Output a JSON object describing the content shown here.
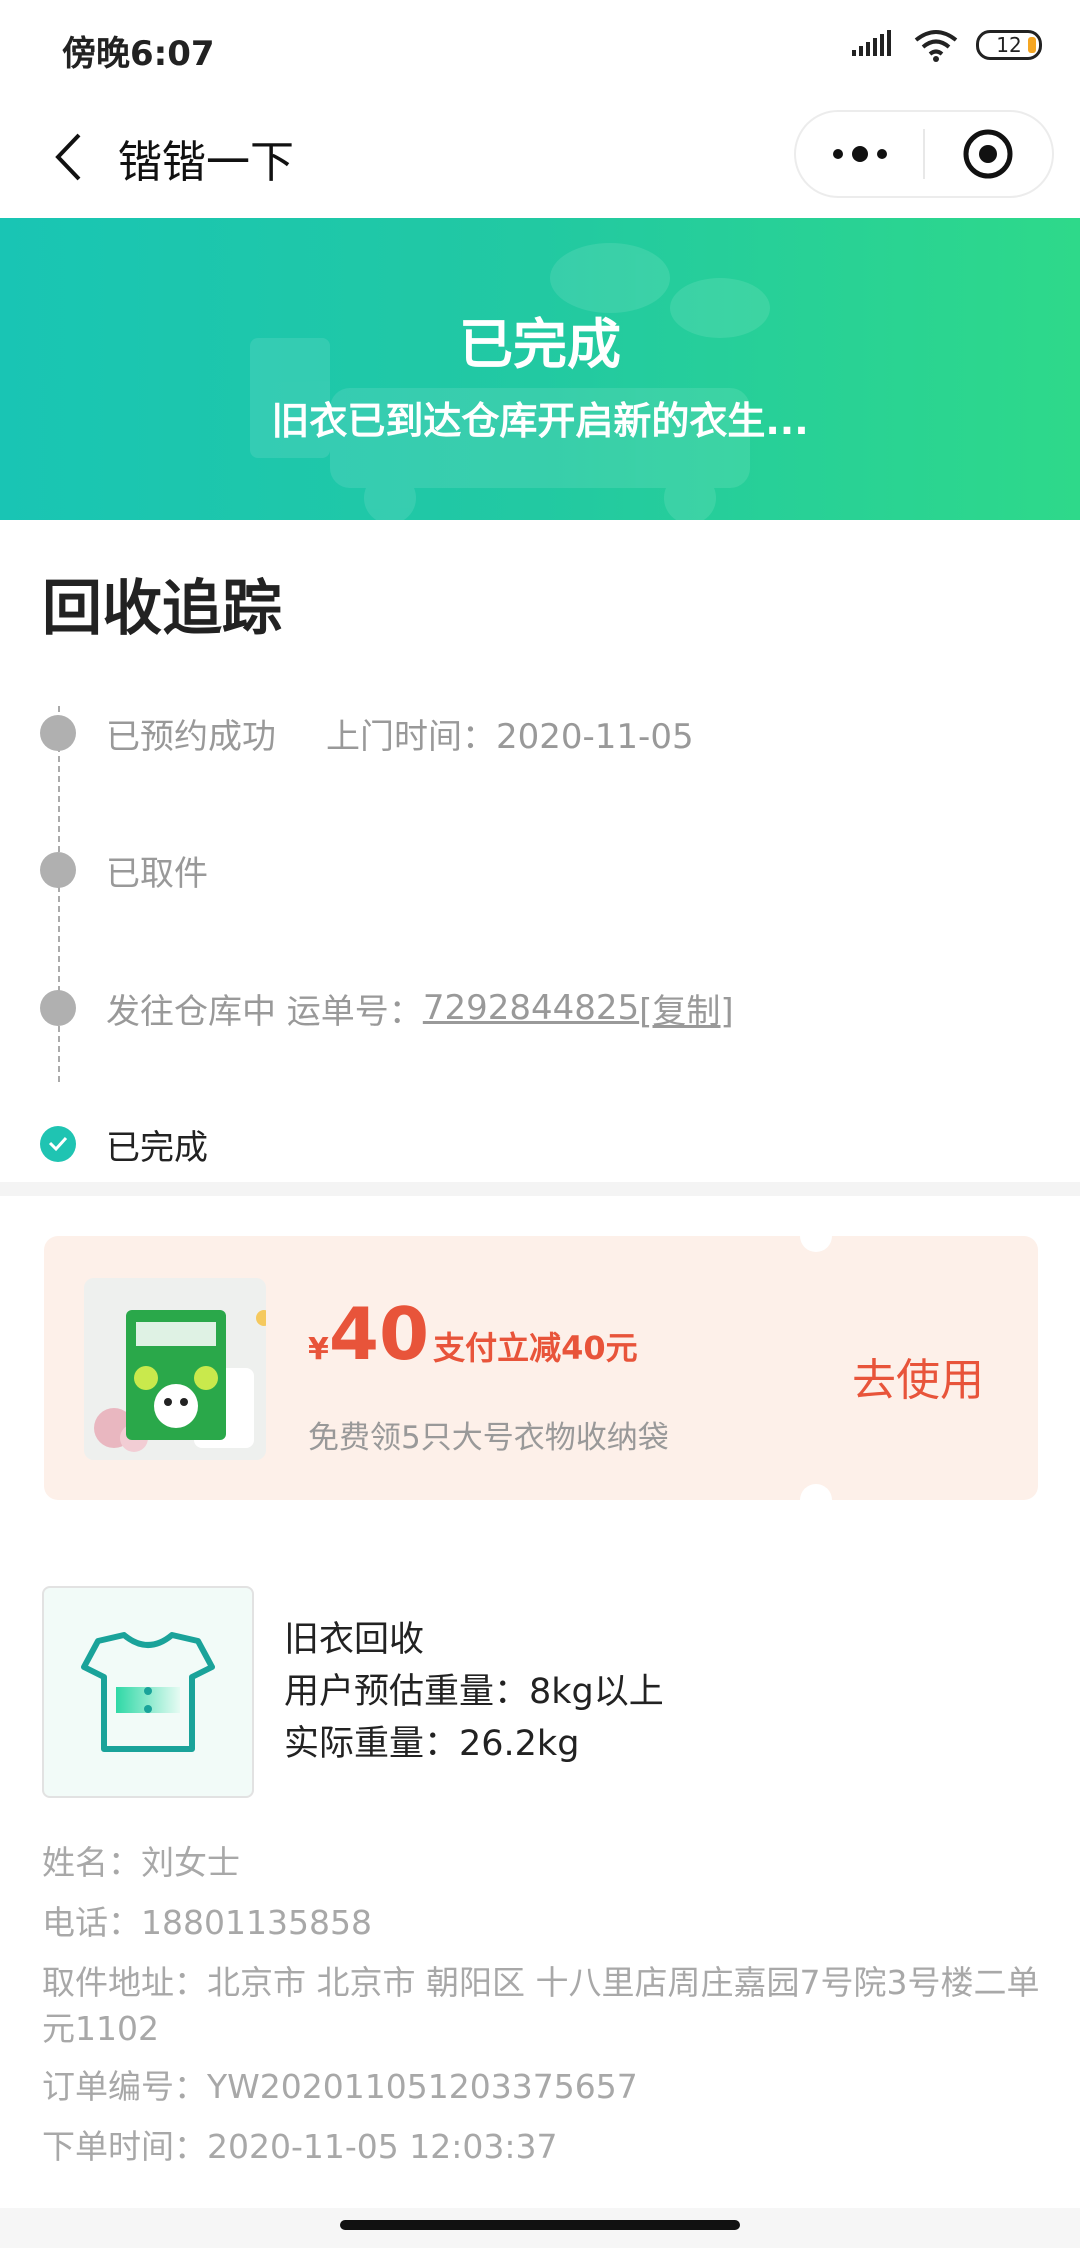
{
  "status_bar": {
    "time": "傍晚6:07",
    "battery": "12"
  },
  "nav": {
    "title": "锴锴一下"
  },
  "banner": {
    "title": "已完成",
    "subtitle": "旧衣已到达仓库开启新的衣生..."
  },
  "tracking": {
    "title": "回收追踪",
    "steps": [
      {
        "label": "已预约成功",
        "extra": "上门时间：2020-11-05"
      },
      {
        "label": "已取件"
      },
      {
        "label": "发往仓库中 运单号：",
        "tracking_no": "7292844825",
        "copy": "[复制]"
      },
      {
        "label": "已完成"
      }
    ]
  },
  "coupon": {
    "currency": "¥",
    "amount": "40",
    "amount_desc": "支付立减40元",
    "desc": "免费领5只大号衣物收纳袋",
    "action": "去使用"
  },
  "order": {
    "type": "旧衣回收",
    "estimated_weight": "用户预估重量：8kg以上",
    "actual_weight": "实际重量：26.2kg",
    "name": "姓名：刘女士",
    "phone": "电话：18801135858",
    "address": "取件地址：北京市 北京市 朝阳区 十八里店周庄嘉园7号院3号楼二单元1102",
    "order_no": "订单编号：YW20201105120337565​7",
    "order_time": "下单时间：2020-11-05 12:03:37"
  },
  "colors": {
    "accent": "#1fc4b2",
    "coupon_red": "#e8543a",
    "banner_start": "#19c5b4",
    "banner_end": "#2ed98a"
  }
}
